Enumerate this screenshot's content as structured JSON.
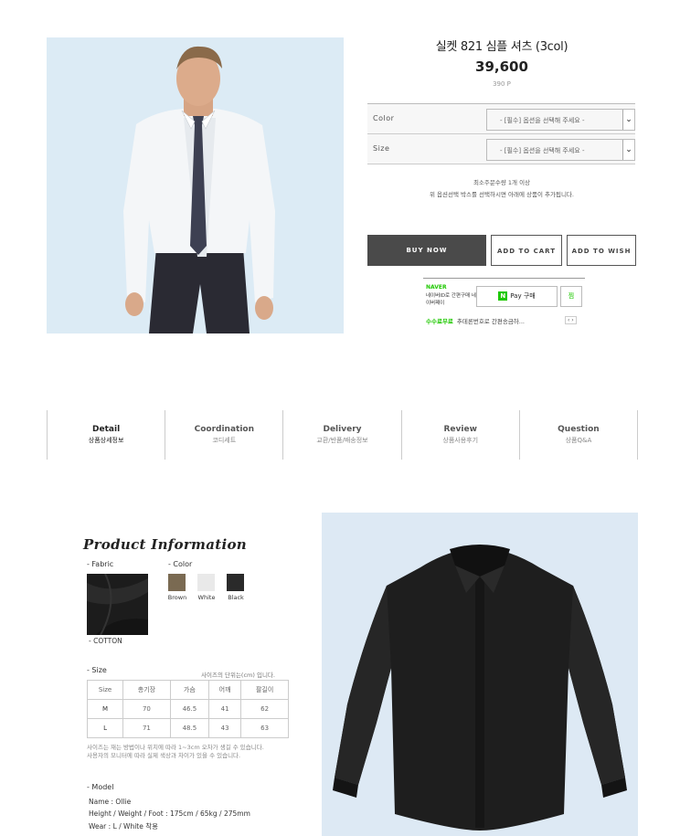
{
  "product": {
    "title": "실켓 821 심플 셔츠 (3col)",
    "price": "39,600",
    "points": "390 P"
  },
  "options": [
    {
      "label": "Color",
      "value": "- [필수] 옵션을 선택해 주세요 -"
    },
    {
      "label": "Size",
      "value": "- [필수] 옵션을 선택해 주세요 -"
    }
  ],
  "notice": {
    "line1": "최소주문수량 1개 이상",
    "line2": "위 옵션선택 박스를 선택하시면 아래에 상품이 추가됩니다."
  },
  "buttons": {
    "buy": "BUY NOW",
    "cart": "ADD TO CART",
    "wish": "ADD TO WISH"
  },
  "npay": {
    "brand": "NAVER",
    "desc": "네이버ID로 간편구매 네이버페이",
    "pay_label": "Pay 구매",
    "zzim": "찜",
    "promo_tag": "수수료무료",
    "promo_text": "추데론번호로 간편송금하..."
  },
  "tabs": [
    {
      "en": "Detail",
      "ko": "상품상세정보"
    },
    {
      "en": "Coordination",
      "ko": "코디세트"
    },
    {
      "en": "Delivery",
      "ko": "교환/반품/배송정보"
    },
    {
      "en": "Review",
      "ko": "상품사용후기"
    },
    {
      "en": "Question",
      "ko": "상품Q&A"
    }
  ],
  "info": {
    "title": "Product Information",
    "fabric_label": "- Fabric",
    "fabric_value": "- COTTON",
    "color_label": "- Color",
    "colors": [
      {
        "name": "Brown",
        "hex": "#7a6a52"
      },
      {
        "name": "White",
        "hex": "#e9e9e9"
      },
      {
        "name": "Black",
        "hex": "#2a2a2a"
      }
    ],
    "size_label": "- Size",
    "size_note": "사이즈의 단위는(cm) 입니다.",
    "size_headers": [
      "Size",
      "총기장",
      "가슴",
      "어깨",
      "팔길이"
    ],
    "size_rows": [
      [
        "M",
        "70",
        "46.5",
        "41",
        "62"
      ],
      [
        "L",
        "71",
        "48.5",
        "43",
        "63"
      ]
    ],
    "disclaimer1": "사이즈는 재는 방법이나 위치에 따라 1~3cm 오차가 생길 수 있습니다.",
    "disclaimer2": "사용자의 모니터에 따라 실제 색상과 차이가 있을 수 있습니다.",
    "model_label": "- Model",
    "model_name": "Name : Ollie",
    "model_body": "Height / Weight / Foot : 175cm / 65kg / 275mm",
    "model_wear": "Wear : L / White 착용"
  }
}
